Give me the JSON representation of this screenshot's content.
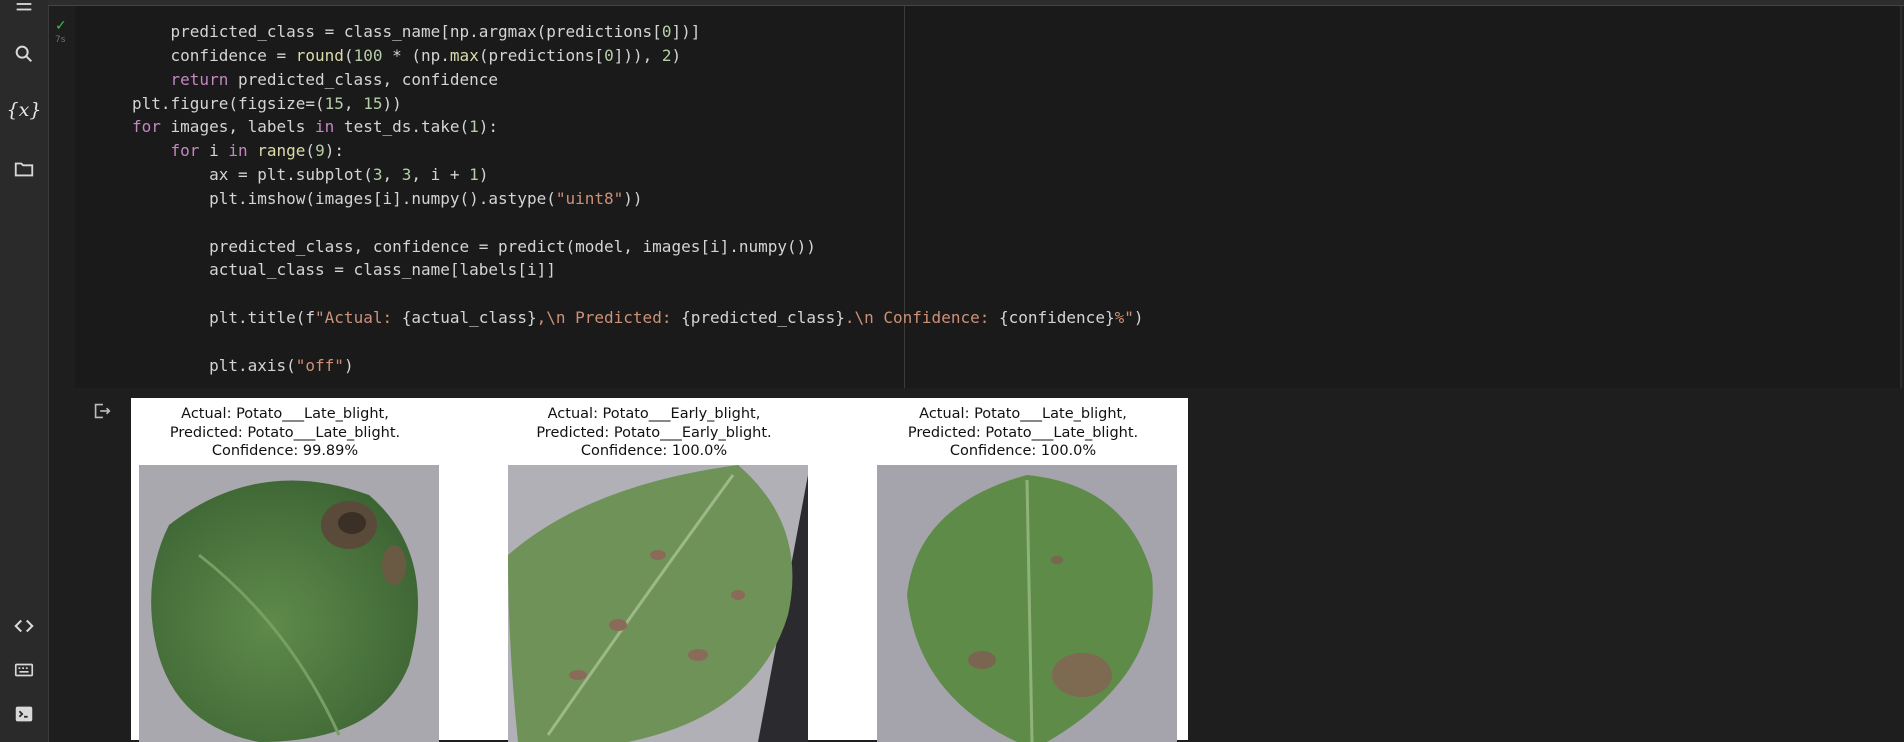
{
  "sidebar": {
    "icons": [
      "menu-icon",
      "search-icon",
      "variables-icon",
      "folder-icon",
      "code-snippets-icon",
      "command-palette-icon",
      "terminal-icon"
    ],
    "variables_label": "{x}"
  },
  "cell": {
    "status": "✓",
    "exec_time": "7s",
    "code_lines": [
      "    predicted_class = class_name[np.argmax(predictions[0])]",
      "    confidence = round(100 * (np.max(predictions[0])), 2)",
      "    return predicted_class, confidence",
      "plt.figure(figsize=(15, 15))",
      "for images, labels in test_ds.take(1):",
      "    for i in range(9):",
      "        ax = plt.subplot(3, 3, i + 1)",
      "        plt.imshow(images[i].numpy().astype(\"uint8\"))",
      "",
      "        predicted_class, confidence = predict(model, images[i].numpy())",
      "        actual_class = class_name[labels[i]]",
      "",
      "        plt.title(f\"Actual: {actual_class},\\n Predicted: {predicted_class}.\\n Confidence: {confidence}%\")",
      "",
      "        plt.axis(\"off\")"
    ]
  },
  "output": {
    "panels": [
      {
        "title_line1": "Actual: Potato___Late_blight,",
        "title_line2": "Predicted: Potato___Late_blight.",
        "title_line3": "Confidence: 99.89%"
      },
      {
        "title_line1": "Actual: Potato___Early_blight,",
        "title_line2": "Predicted: Potato___Early_blight.",
        "title_line3": "Confidence: 100.0%"
      },
      {
        "title_line1": "Actual: Potato___Late_blight,",
        "title_line2": "Predicted: Potato___Late_blight.",
        "title_line3": "Confidence: 100.0%"
      }
    ]
  },
  "colors": {
    "editor_bg": "#1a1a1a",
    "keyword": "#c586c0",
    "builtin": "#dcdcaa",
    "number": "#b5cea8",
    "string": "#ce9178",
    "success": "#3fb950"
  }
}
